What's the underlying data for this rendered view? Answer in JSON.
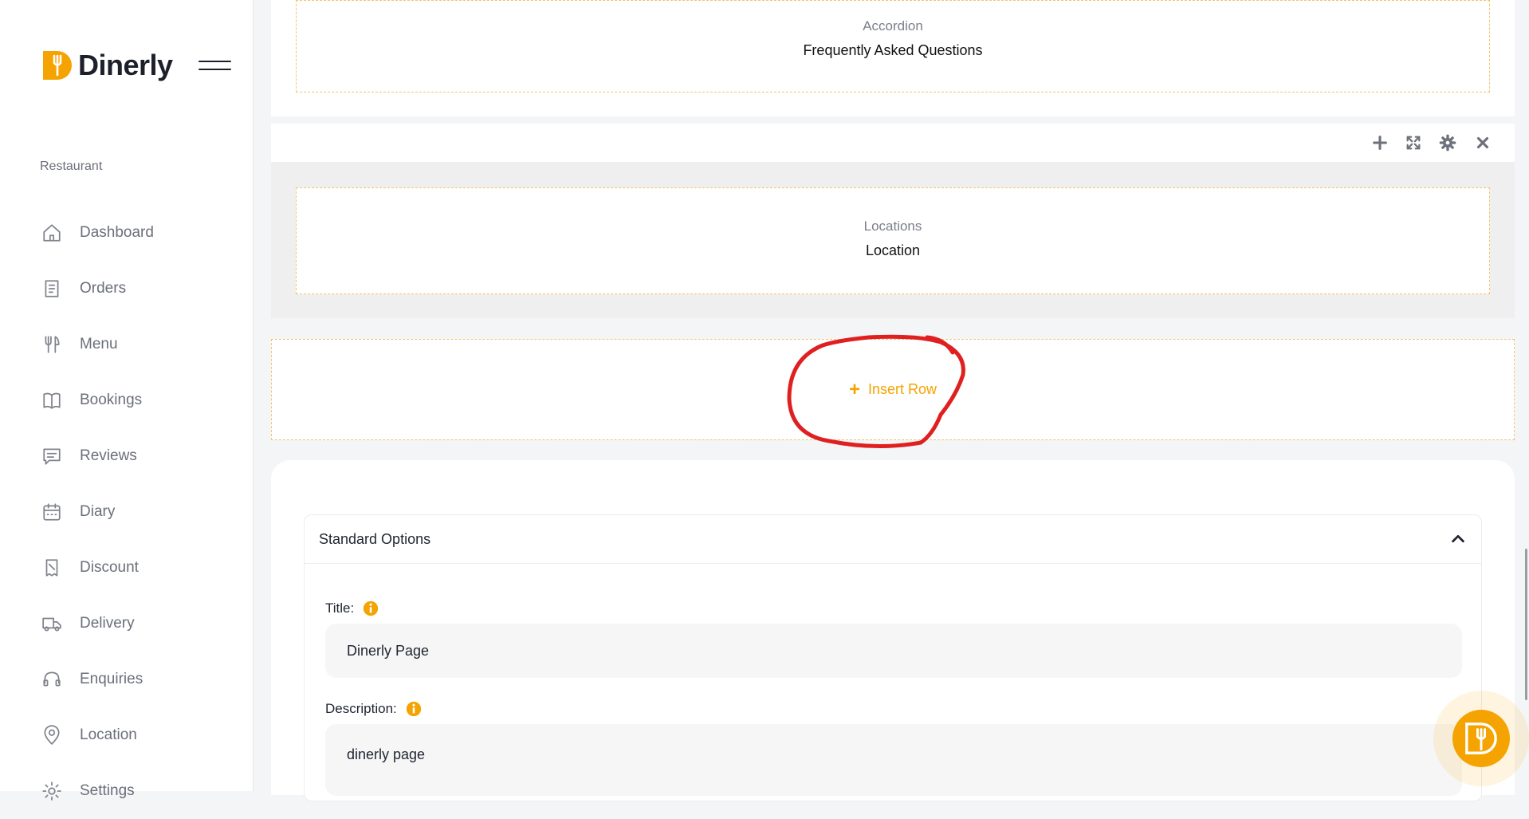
{
  "brand": {
    "name": "Dinerly",
    "color": "#F5A300"
  },
  "sidebar": {
    "section": "Restaurant",
    "items": [
      {
        "label": "Dashboard",
        "icon": "home-icon"
      },
      {
        "label": "Orders",
        "icon": "receipt-icon"
      },
      {
        "label": "Menu",
        "icon": "fork-knife-icon"
      },
      {
        "label": "Bookings",
        "icon": "book-icon"
      },
      {
        "label": "Reviews",
        "icon": "message-icon"
      },
      {
        "label": "Diary",
        "icon": "calendar-icon"
      },
      {
        "label": "Discount",
        "icon": "ticket-icon"
      },
      {
        "label": "Delivery",
        "icon": "truck-icon"
      },
      {
        "label": "Enquiries",
        "icon": "headset-icon"
      },
      {
        "label": "Location",
        "icon": "map-pin-icon"
      },
      {
        "label": "Settings",
        "icon": "gear-icon"
      }
    ]
  },
  "blocks": {
    "accordion": {
      "subtitle": "Accordion",
      "title": "Frequently Asked Questions"
    },
    "locations": {
      "subtitle": "Locations",
      "title": "Location"
    }
  },
  "row_toolbar": {
    "icons": [
      "plus-icon",
      "expand-icon",
      "gear-icon",
      "close-icon"
    ]
  },
  "insert_row": {
    "label": "Insert Row",
    "annotation_color": "#E02020"
  },
  "options": {
    "header": "Standard Options",
    "title_label": "Title:",
    "title_value": "Dinerly Page",
    "description_label": "Description:",
    "description_value": "dinerly page"
  }
}
